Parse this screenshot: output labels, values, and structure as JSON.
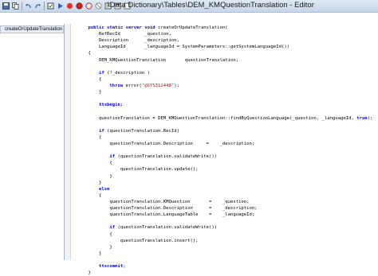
{
  "window": {
    "title": "\\Data Dictionary\\Tables\\DEM_KMQuestionTranslation - Editor"
  },
  "toolbar": {
    "icons": [
      "save-icon",
      "copy-icon",
      "undo-icon",
      "redo-icon",
      "compile-icon",
      "run-icon",
      "stop-icon",
      "breakpoint-icon",
      "toggle-breakpoint-icon",
      "clear-breakpoints-icon",
      "lookup-icon",
      "properties-icon",
      "help-icon"
    ]
  },
  "methods": {
    "items": [
      {
        "label": "createOrUpdateTranslation"
      }
    ]
  },
  "code": {
    "lines": [
      [
        {
          "t": "    "
        },
        {
          "t": "public static server void",
          "k": "kw"
        },
        {
          "t": " createOrUpdateTranslation("
        }
      ],
      [
        {
          "t": "        RefRecId         _question,"
        }
      ],
      [
        {
          "t": "        Description      _description,"
        }
      ],
      [
        {
          "t": "        LanguageId       _languageId = SystemParameters::getSystemLanguageId())"
        }
      ],
      [
        {
          "t": "    {"
        }
      ],
      [
        {
          "t": "        DEM_KMQuestionTranslation       questionTranslation;"
        }
      ],
      [
        {
          "t": ""
        }
      ],
      [
        {
          "t": "        "
        },
        {
          "t": "if",
          "k": "kw"
        },
        {
          "t": " (!_description )"
        }
      ],
      [
        {
          "t": "        {"
        }
      ],
      [
        {
          "t": "            "
        },
        {
          "t": "throw",
          "k": "kw"
        },
        {
          "t": " error("
        },
        {
          "t": "\"@SYS312448\"",
          "k": "str"
        },
        {
          "t": ");"
        }
      ],
      [
        {
          "t": "        }"
        }
      ],
      [
        {
          "t": ""
        }
      ],
      [
        {
          "t": "        "
        },
        {
          "t": "ttsbegin",
          "k": "kw"
        },
        {
          "t": ";"
        }
      ],
      [
        {
          "t": ""
        }
      ],
      [
        {
          "t": "        questionTranslation = DEM_KMQuestionTranslation::findByQuestionLanguage(_question, _languageId, "
        },
        {
          "t": "true",
          "k": "kw"
        },
        {
          "t": ");"
        }
      ],
      [
        {
          "t": ""
        }
      ],
      [
        {
          "t": "        "
        },
        {
          "t": "if",
          "k": "kw"
        },
        {
          "t": " (questionTranslation.RecId)"
        }
      ],
      [
        {
          "t": "        {"
        }
      ],
      [
        {
          "t": "            questionTranslation.Description     =    _description;"
        }
      ],
      [
        {
          "t": ""
        }
      ],
      [
        {
          "t": "            "
        },
        {
          "t": "if",
          "k": "kw"
        },
        {
          "t": " (questionTranslation.validateWrite())"
        }
      ],
      [
        {
          "t": "            {"
        }
      ],
      [
        {
          "t": "                questionTranslation.update();"
        }
      ],
      [
        {
          "t": "            }"
        }
      ],
      [
        {
          "t": "        }"
        }
      ],
      [
        {
          "t": "        "
        },
        {
          "t": "else",
          "k": "kw"
        }
      ],
      [
        {
          "t": "        {"
        }
      ],
      [
        {
          "t": "            questionTranslation.KMQuestion       =    _question;"
        }
      ],
      [
        {
          "t": "            questionTranslation.Description      =    _description;"
        }
      ],
      [
        {
          "t": "            questionTranslation.LanguageTable    =    _languageId;"
        }
      ],
      [
        {
          "t": ""
        }
      ],
      [
        {
          "t": "            "
        },
        {
          "t": "if",
          "k": "kw"
        },
        {
          "t": " (questionTranslation.validateWrite())"
        }
      ],
      [
        {
          "t": "            {"
        }
      ],
      [
        {
          "t": "                questionTranslation.insert();"
        }
      ],
      [
        {
          "t": "            }"
        }
      ],
      [
        {
          "t": "        }"
        }
      ],
      [
        {
          "t": ""
        }
      ],
      [
        {
          "t": "        "
        },
        {
          "t": "ttscommit",
          "k": "kw"
        },
        {
          "t": ";"
        }
      ],
      [
        {
          "t": "    }"
        }
      ]
    ]
  }
}
